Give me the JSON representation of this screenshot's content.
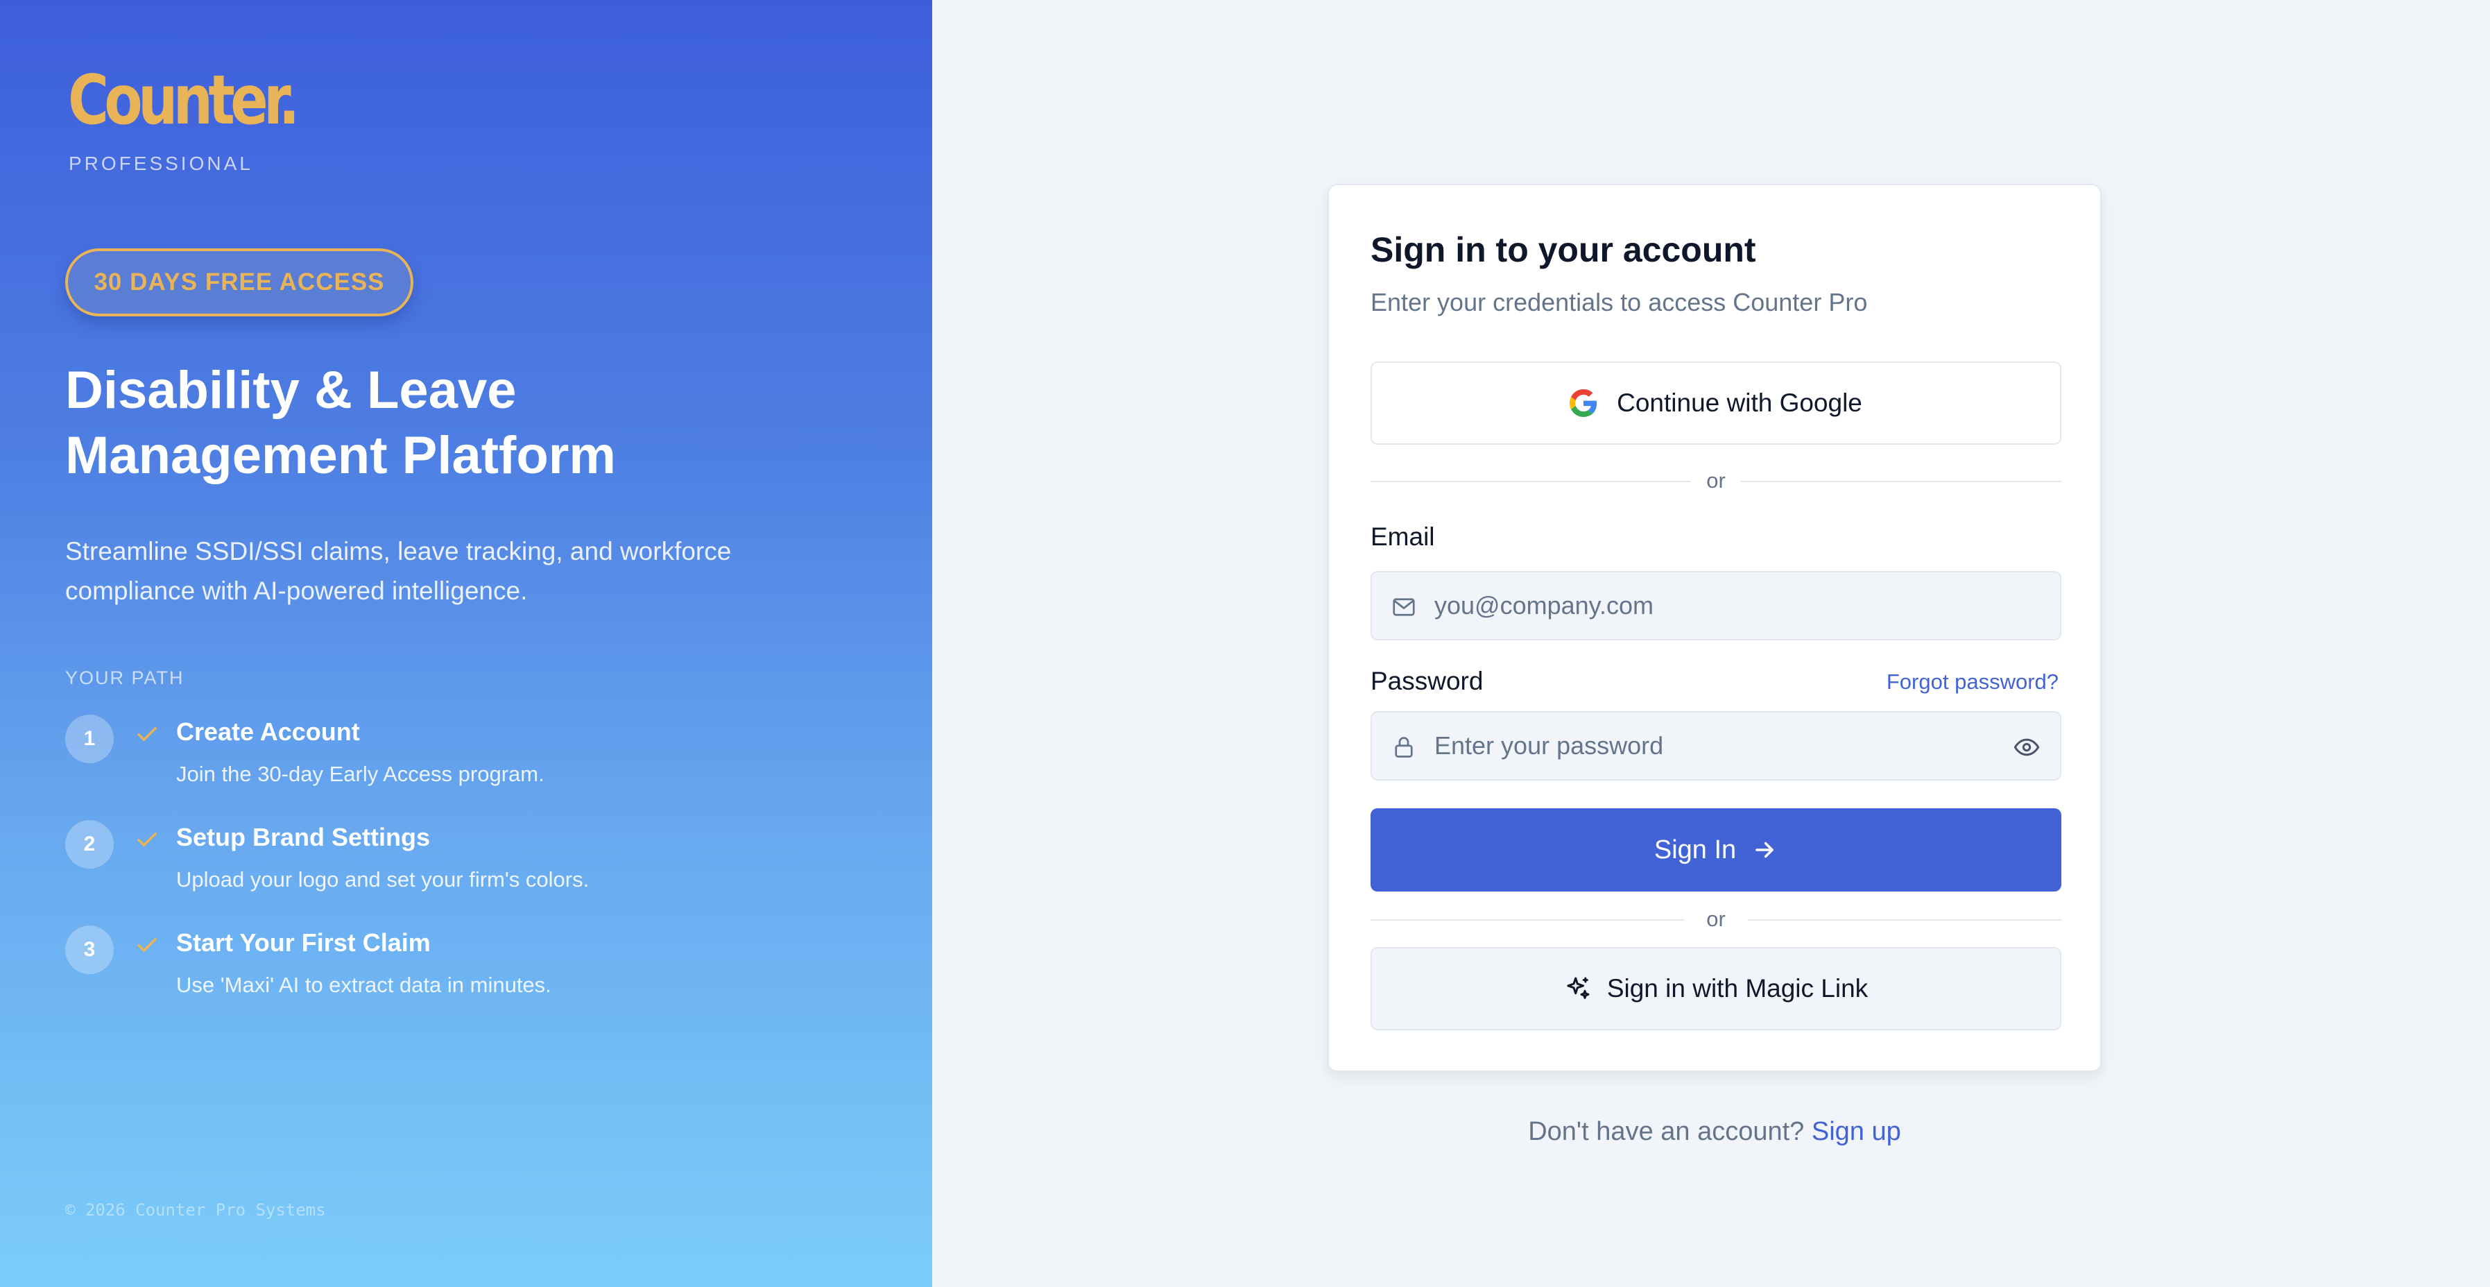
{
  "brand": {
    "logo": "Counter.",
    "tagline": "PROFESSIONAL",
    "badge": "30 DAYS FREE ACCESS",
    "headline_1": "Disability & Leave",
    "headline_2": "Management Platform",
    "description": "Streamline SSDI/SSI claims, leave tracking, and workforce compliance with AI-powered intelligence.",
    "path_label": "YOUR PATH",
    "accent_color": "#e8b457",
    "steps": [
      {
        "num": "1",
        "title": "Create Account",
        "text": "Join the 30-day Early Access program."
      },
      {
        "num": "2",
        "title": "Setup Brand Settings",
        "text": "Upload your logo and set your firm's colors."
      },
      {
        "num": "3",
        "title": "Start Your First Claim",
        "text": "Use 'Maxi' AI to extract data in minutes."
      }
    ],
    "copyright": "© 2026 Counter Pro Systems"
  },
  "signin": {
    "title": "Sign in to your account",
    "subtitle": "Enter your credentials to access Counter Pro",
    "google_label": "Continue with Google",
    "or_text": "or",
    "email_label": "Email",
    "email_placeholder": "you@company.com",
    "email_value": "",
    "password_label": "Password",
    "forgot_label": "Forgot password?",
    "password_placeholder": "Enter your password",
    "password_value": "",
    "signin_label": "Sign In",
    "magic_label": "Sign in with Magic Link",
    "no_account": "Don't have an account?",
    "signup_label": "Sign up",
    "primary_color": "#4263d6"
  },
  "icons": {
    "google": "google-icon",
    "step_check": "check-icon",
    "email": "mail-icon",
    "password": "lock-icon",
    "reveal": "eye-icon",
    "submit": "arrow-right-icon",
    "magic": "sparkles-icon"
  }
}
